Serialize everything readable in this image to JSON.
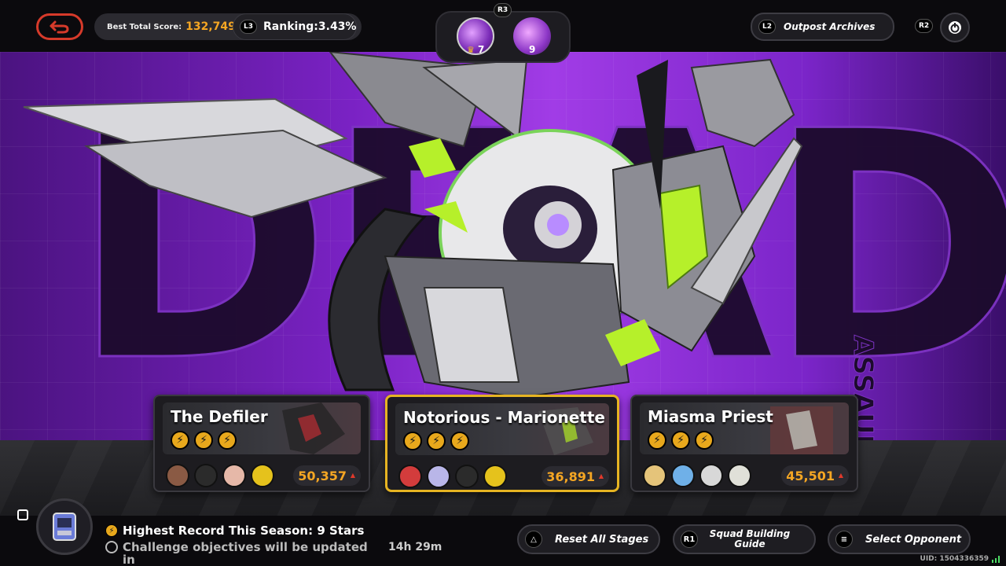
{
  "topbar": {
    "best_score_label": "Best Total Score:",
    "best_score_value": "132,749",
    "ranking_button": "L3",
    "ranking_text": "Ranking:3.43%",
    "medal_button": "R3",
    "medal_1_count": "7",
    "medal_2_count": "9",
    "archives_button": "L2",
    "archives_label": "Outpost Archives",
    "power_button": "R2"
  },
  "stage": {
    "big_word": "DEADLY",
    "side_word": "ASSAULT"
  },
  "cards": [
    {
      "name": "The Defiler",
      "stars": [
        "⚡",
        "⚡",
        "⚡"
      ],
      "score": "50,357",
      "avatar_colors": [
        "#8a5a44",
        "#2b2b2b",
        "#e6b8a8",
        "#e5c21c"
      ],
      "selected": false
    },
    {
      "name": "Notorious - Marionette",
      "stars": [
        "⚡",
        "⚡",
        "⚡"
      ],
      "score": "36,891",
      "avatar_colors": [
        "#d33c3c",
        "#b9b6e8",
        "#2b2b2b",
        "#e5c21c"
      ],
      "selected": true
    },
    {
      "name": "Miasma Priest",
      "stars": [
        "⚡",
        "⚡",
        "⚡"
      ],
      "score": "45,501",
      "avatar_colors": [
        "#e5c47a",
        "#6fb0e8",
        "#d8d8d8",
        "#e0e0d8"
      ],
      "selected": false
    }
  ],
  "bottombar": {
    "record_text": "Highest Record This Season: 9 Stars",
    "notice_text": "Challenge objectives will be updated in",
    "timer": "14h 29m",
    "reset_icon": "△",
    "reset_label": "Reset All Stages",
    "guide_button": "R1",
    "guide_label": "Squad Building Guide",
    "select_icon": "≡",
    "select_label": "Select Opponent",
    "uid": "UID: 1504336359"
  },
  "colors": {
    "accent_gold": "#f5a623",
    "selected_border": "#e6b422",
    "back_red": "#d63a2a",
    "stage_purple": "#a13ce6"
  },
  "icons": {
    "back": "back-arrow-icon",
    "power": "power-icon",
    "inventory": "inventory-icon",
    "crown": "crown-icon"
  }
}
